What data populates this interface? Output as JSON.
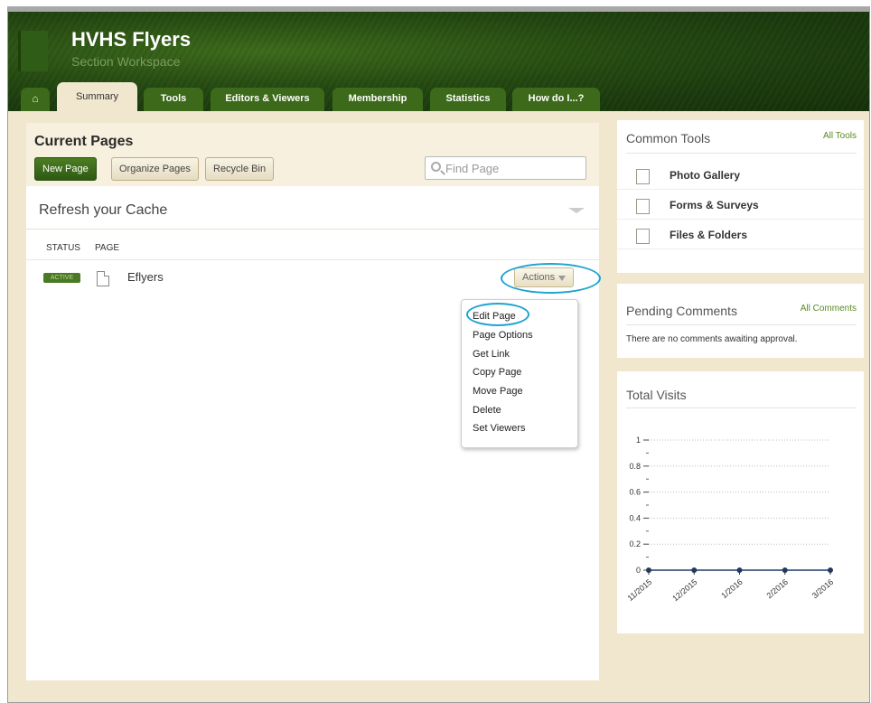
{
  "header": {
    "title": "HVHS Flyers",
    "subtitle": "Section Workspace"
  },
  "tabs": [
    {
      "label": "Summary",
      "active": true
    },
    {
      "label": "Tools"
    },
    {
      "label": "Editors & Viewers"
    },
    {
      "label": "Membership"
    },
    {
      "label": "Statistics"
    },
    {
      "label": "How do I...?"
    }
  ],
  "home_icon": "home-icon",
  "main": {
    "title": "Current Pages",
    "new_page": "New Page",
    "organize_pages": "Organize Pages",
    "recycle_bin": "Recycle Bin",
    "find_placeholder": "Find Page",
    "cache_title": "Refresh your Cache",
    "columns": {
      "status": "STATUS",
      "page": "PAGE"
    },
    "row": {
      "status": "ACTIVE",
      "page_name": "Eflyers",
      "actions": "Actions"
    },
    "menu": [
      "Edit Page",
      "Page Options",
      "Get Link",
      "Copy Page",
      "Move Page",
      "Delete",
      "Set Viewers"
    ]
  },
  "sidebar": {
    "tools": {
      "title": "Common Tools",
      "link": "All Tools",
      "items": [
        "Photo Gallery",
        "Forms & Surveys",
        "Files & Folders"
      ]
    },
    "comments": {
      "title": "Pending Comments",
      "link": "All Comments",
      "empty": "There are no comments awaiting approval."
    },
    "visits": {
      "title": "Total Visits"
    }
  },
  "colors": {
    "accent_green": "#3c6a1a",
    "highlight_circle": "#1ea3d0",
    "line": "#1f3a66"
  },
  "chart_data": {
    "type": "line",
    "title": "",
    "categories": [
      "11/2015",
      "12/2015",
      "1/2016",
      "2/2016",
      "3/2016"
    ],
    "series": [
      {
        "values": [
          0,
          0,
          0,
          0,
          0
        ]
      }
    ],
    "yticks": [
      "0",
      "0.2",
      "0.4",
      "0.6",
      "0.8",
      "1"
    ],
    "ylim": [
      0,
      1
    ],
    "grid": true
  }
}
